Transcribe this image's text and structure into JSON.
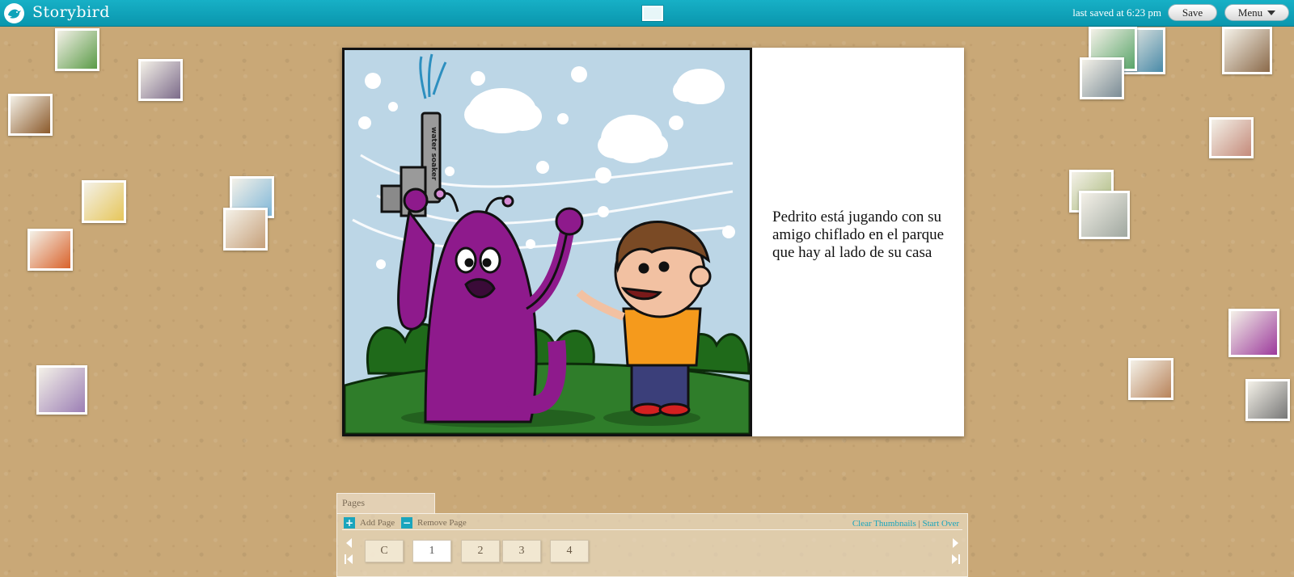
{
  "app": {
    "name": "Storybird",
    "saved_status": "last saved at 6:23 pm",
    "save_label": "Save",
    "menu_label": "Menu"
  },
  "book": {
    "text": "Pedrito está jugando con su amigo chiflado en el parque que hay al lado de su casa",
    "art_elements": {
      "water_gun_label": "water soaker"
    }
  },
  "pages_panel": {
    "tab_label": "Pages",
    "add_page_label": "Add Page",
    "remove_page_label": "Remove Page",
    "clear_thumbnails_label": "Clear Thumbnails",
    "separator": "|",
    "start_over_label": "Start Over",
    "pages": [
      {
        "label": "C",
        "active": false
      },
      {
        "label": "1",
        "active": true
      },
      {
        "label": "2",
        "active": false
      },
      {
        "label": "3",
        "active": false
      },
      {
        "label": "4",
        "active": false
      }
    ]
  },
  "colors": {
    "topbar": "#0ea3b9",
    "accent": "#1aa5bd",
    "corkboard": "#c9a877",
    "monster_purple": "#8e1a8c",
    "sky": "#bcd6e6",
    "grass": "#2f7d2a"
  },
  "thumbnails": [
    {
      "name": "thumb-kids-garden",
      "color": "#5b9b48"
    },
    {
      "name": "thumb-bear-forest",
      "color": "#7c6b8a"
    },
    {
      "name": "thumb-gramophone-heart",
      "color": "#8b5a2b"
    },
    {
      "name": "thumb-ice-cream-shop",
      "color": "#e6c65a"
    },
    {
      "name": "thumb-robot-sunset",
      "color": "#d9622b"
    },
    {
      "name": "thumb-city-man",
      "color": "#7fb7d9"
    },
    {
      "name": "thumb-robot-pattern",
      "color": "#c6a07a"
    },
    {
      "name": "thumb-car-fishbowl",
      "color": "#9c7fb5"
    },
    {
      "name": "thumb-robot-blue",
      "color": "#4a8aa8"
    },
    {
      "name": "thumb-cat-wine",
      "color": "#8b6a4a"
    },
    {
      "name": "thumb-green-robot",
      "color": "#5aa56a"
    },
    {
      "name": "thumb-city-street",
      "color": "#7a8c96"
    },
    {
      "name": "thumb-mustache-man",
      "color": "#c48a7a"
    },
    {
      "name": "thumb-building-green",
      "color": "#a8b87a"
    },
    {
      "name": "thumb-elephant-car",
      "color": "#a0a8a0"
    },
    {
      "name": "thumb-monster-boy",
      "color": "#9c3a9c"
    },
    {
      "name": "thumb-gingerbread",
      "color": "#b8835a"
    },
    {
      "name": "thumb-robot-heart",
      "color": "#777777"
    }
  ]
}
